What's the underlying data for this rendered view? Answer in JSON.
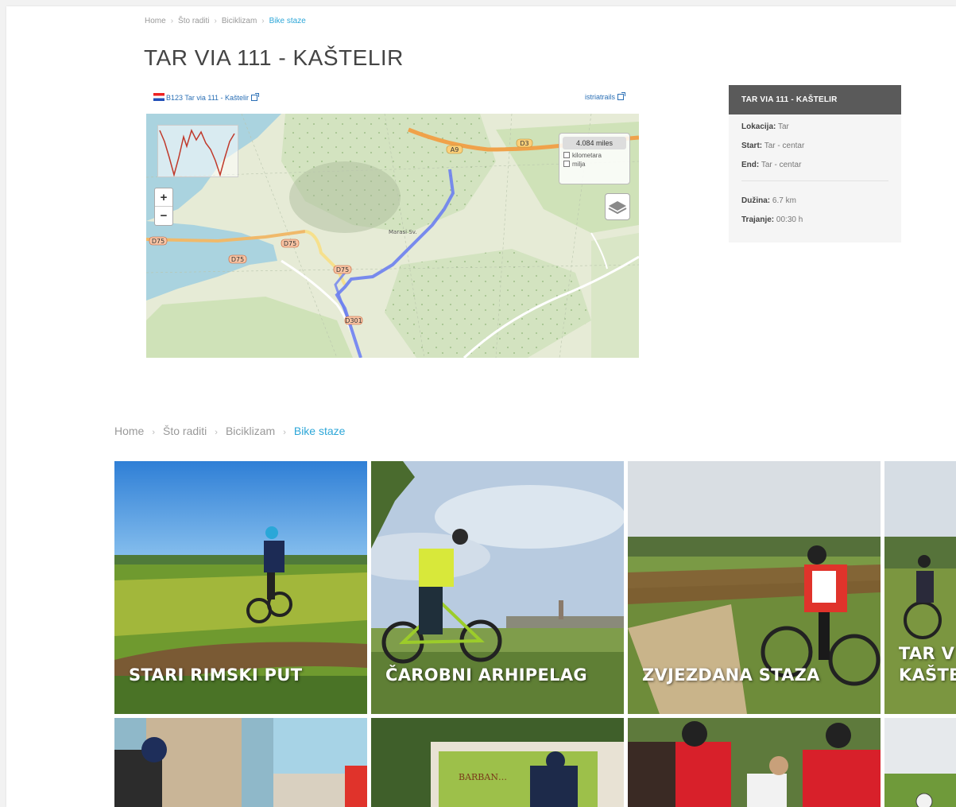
{
  "breadcrumb_top": {
    "home": "Home",
    "what_to_do": "Što raditi",
    "cycling": "Biciklizam",
    "current": "Bike staze"
  },
  "page_title": "TAR VIA 111 - KAŠTELIR",
  "map": {
    "track_link": "B123 Tar via 111 - Kaštelir",
    "source_link": "istriatrails",
    "zoom_in": "+",
    "zoom_out": "−",
    "distance": "4.084 miles",
    "units": [
      "kilometara",
      "milja"
    ],
    "road_labels": [
      "A9",
      "D3",
      "D75",
      "D75",
      "D75",
      "D75",
      "D301"
    ],
    "place_label": "Marasi Sv.",
    "route_color": "#6b7ff0"
  },
  "info": {
    "title": "TAR VIA 111 - KAŠTELIR",
    "location_label": "Lokacija:",
    "location": "Tar",
    "start_label": "Start:",
    "start": "Tar - centar",
    "end_label": "End:",
    "end": "Tar - centar",
    "length_label": "Dužina:",
    "length": "6.7 km",
    "duration_label": "Trajanje:",
    "duration": "00:30 h"
  },
  "breadcrumb_mid": {
    "home": "Home",
    "what_to_do": "Što raditi",
    "cycling": "Biciklizam",
    "current": "Bike staze"
  },
  "tiles": [
    {
      "label": "STARI RIMSKI PUT"
    },
    {
      "label": "ČAROBNI ARHIPELAG"
    },
    {
      "label": "ZVJEZDANA STAZA"
    },
    {
      "label_line1": "TAR V",
      "label_line2": "KAŠTE"
    }
  ],
  "colors": {
    "accent": "#2ea7d8",
    "info_header": "#5a5a5a"
  }
}
